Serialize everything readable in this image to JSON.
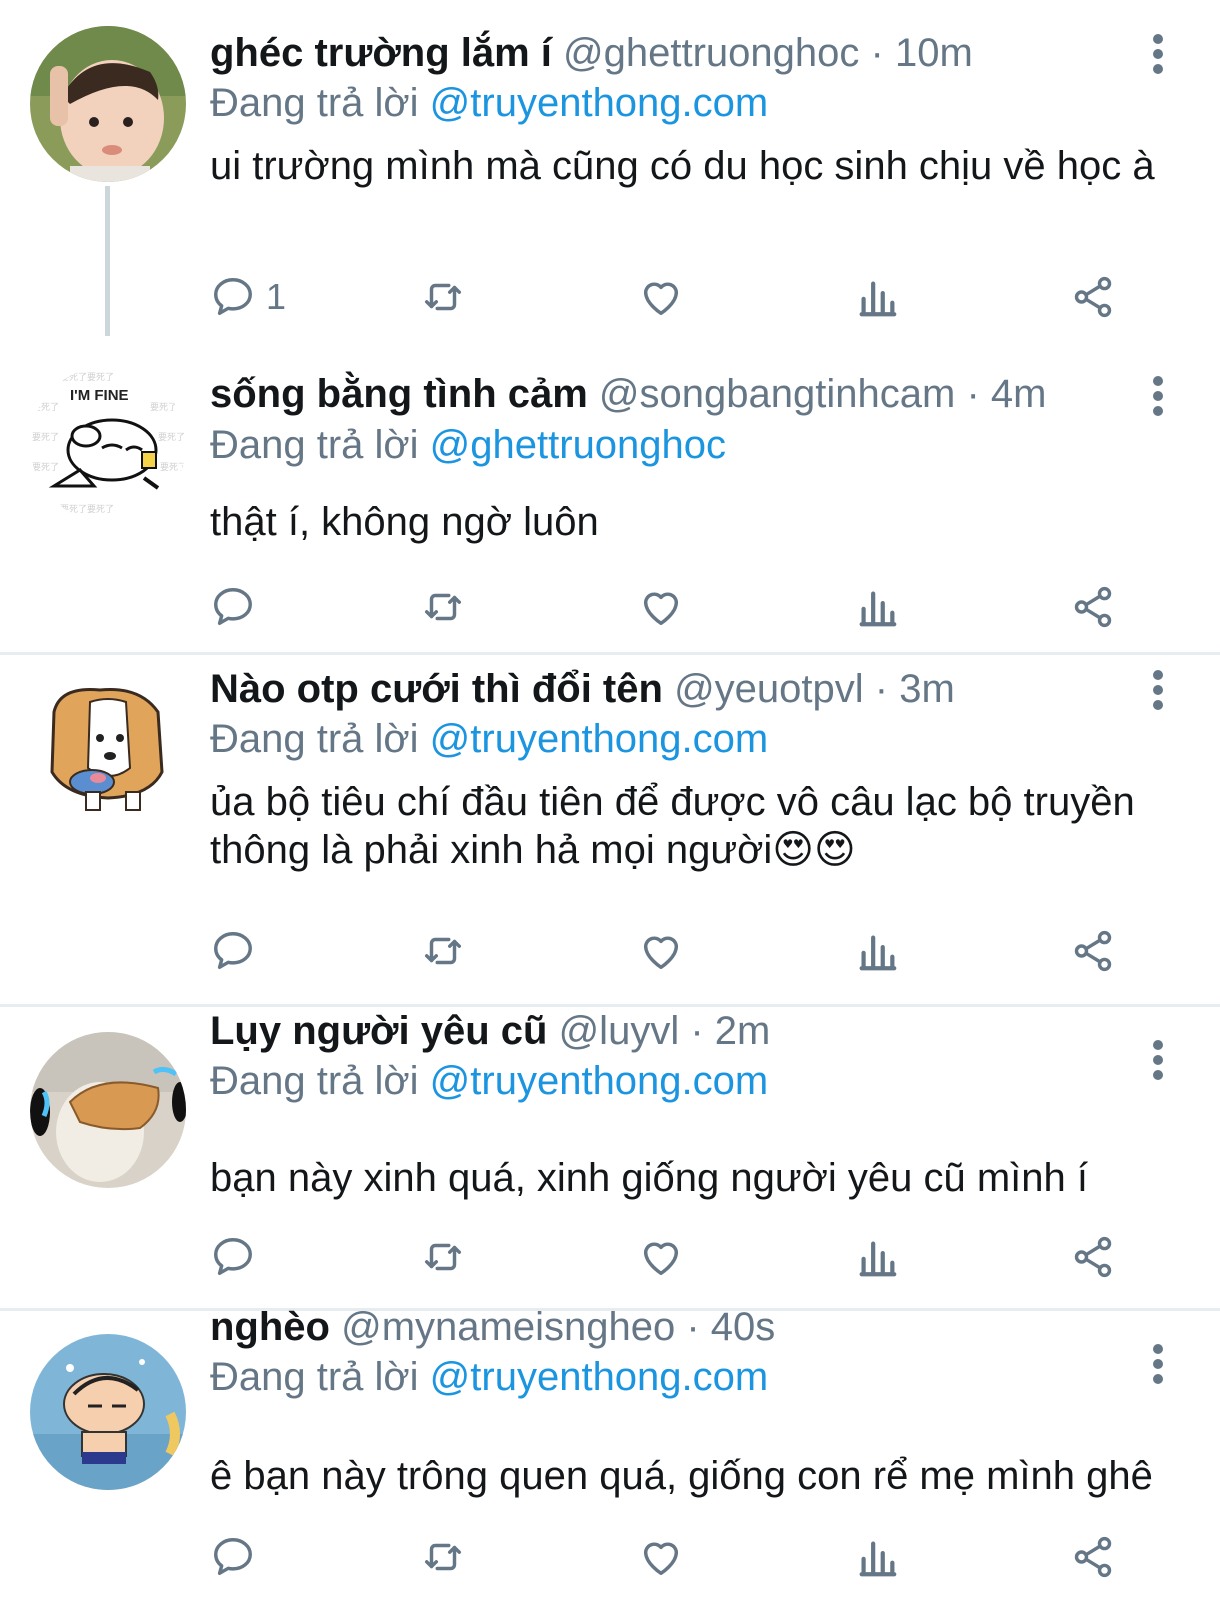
{
  "reply_prefix": "Đang trả lời",
  "colors": {
    "mention": "#1b95e0",
    "secondary": "#657786",
    "separator": "#e6ecf0"
  },
  "tweets": [
    {
      "name": "ghéc trường lắm í",
      "handle": "@ghettruonghoc",
      "time": "10m",
      "reply_to": "@truyenthong.com",
      "text": "ui trường mình mà cũng có du học sinh chịu về học à",
      "reply_count": "1",
      "avatar_icon": "baby-photo-avatar"
    },
    {
      "name": "sống bằng tình cảm",
      "handle": "@songbangtinhcam",
      "time": "4m",
      "reply_to": "@ghettruonghoc",
      "text": "thật í, không ngờ luôn",
      "avatar_text": "I'M FINE",
      "avatar_icon": "cartoon-dog-avatar"
    },
    {
      "name": "Nào otp cưới thì đổi tên",
      "handle": "@yeuotpvl",
      "time": "3m",
      "reply_to": "@truyenthong.com",
      "text": "ủa bộ tiêu chí đầu tiên để được vô câu lạc bộ truyền thông là phải xinh hả mọi người",
      "emojis": "😍😍",
      "avatar_icon": "corgi-sticker-avatar"
    },
    {
      "name": "Lụy người yêu cũ",
      "handle": "@luyvl",
      "time": "2m",
      "reply_to": "@truyenthong.com",
      "text": "bạn này xinh quá, xinh giống người yêu cũ mình í",
      "avatar_icon": "crying-meme-avatar"
    },
    {
      "name": "nghèo",
      "handle": "@mynameisngheo",
      "time": "40s",
      "reply_to": "@truyenthong.com",
      "text": "ê bạn này trông quen quá, giống con rể mẹ mình ghê",
      "avatar_icon": "shin-cartoon-avatar"
    }
  ]
}
